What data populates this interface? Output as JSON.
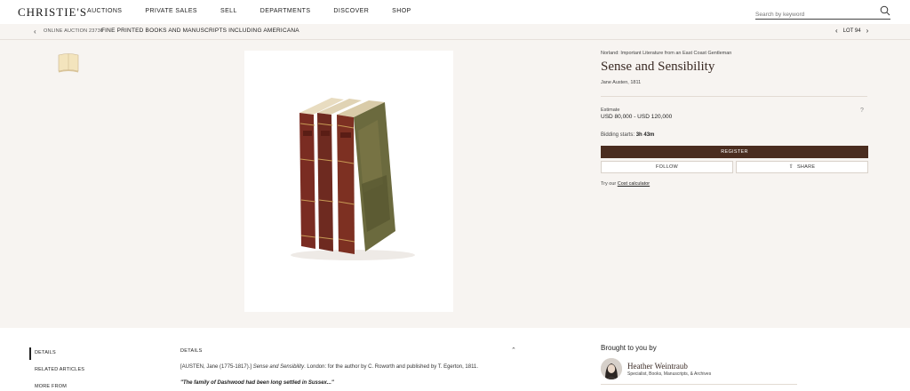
{
  "brand": "CHRISTIE'S",
  "nav": [
    "AUCTIONS",
    "PRIVATE SALES",
    "SELL",
    "DEPARTMENTS",
    "DISCOVER",
    "SHOP"
  ],
  "search": {
    "placeholder": "Search by keyword",
    "icon": "search-icon"
  },
  "breadcrumb": {
    "auction": "ONLINE AUCTION 23736",
    "title": "FINE PRINTED BOOKS AND MANUSCRIPTS INCLUDING AMERICANA"
  },
  "lot_nav": {
    "label": "LOT 94"
  },
  "lot": {
    "provenance": "Norland: Important Literature from an East Coast Gentleman",
    "title": "Sense and Sensibility",
    "author": "Jane Austen, 1811",
    "estimate_label": "Estimate",
    "estimate_value": "USD 80,000 - USD 120,000",
    "help_icon": "?",
    "bidding_label": "Bidding starts:",
    "bidding_value": "3h 43m",
    "register": "REGISTER",
    "follow": "FOLLOW",
    "share": "SHARE",
    "cost_prefix": "Try our",
    "cost_link": "Cost calculator"
  },
  "tabs": [
    "DETAILS",
    "RELATED ARTICLES",
    "MORE FROM"
  ],
  "details": {
    "heading": "DETAILS",
    "line1_prefix": "[AUSTEN, Jane (1775-1817).]",
    "line1_italic": "Sense and Sensibility",
    "line1_suffix": ". London: for the author by C. Roworth and published by T. Egerton, 1811.",
    "quote": "\"The family of Dashwood had been long settled in Sussex...\""
  },
  "specialist": {
    "heading": "Brought to you by",
    "name": "Heather Weintraub",
    "title": "Specialist, Books, Manuscripts, & Archives"
  },
  "colors": {
    "brand_brown": "#4a2c1f",
    "beige": "#f7f4f1",
    "title_brown": "#3a2a24"
  }
}
